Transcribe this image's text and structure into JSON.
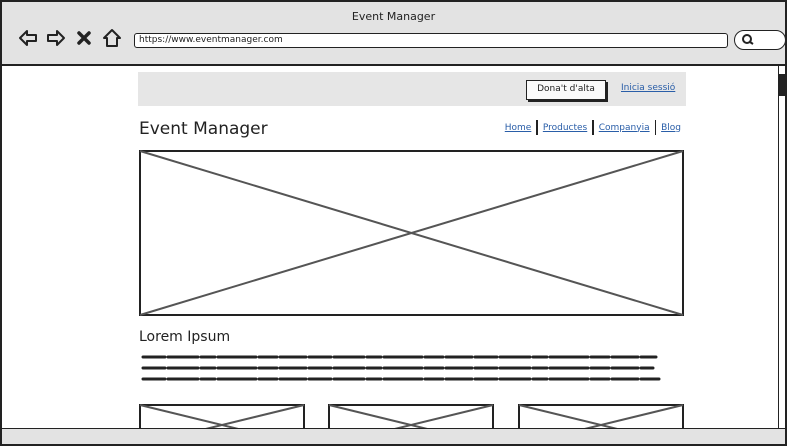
{
  "window": {
    "title": "Event Manager"
  },
  "browser": {
    "url": "https://www.eventmanager.com",
    "icons": [
      "back-arrow-icon",
      "forward-arrow-icon",
      "close-x-icon",
      "home-icon",
      "search-icon"
    ]
  },
  "header": {
    "signup_label": "Dona't d'alta",
    "login_label": "Inicia sessió"
  },
  "site": {
    "brand": "Event Manager",
    "nav": [
      "Home",
      "Productes",
      "Companyia",
      "Blog"
    ]
  },
  "content": {
    "section_title": "Lorem Ipsum"
  },
  "colors": {
    "link": "#2a5ea8",
    "chrome": "#e3e3e3",
    "header_bar": "#e6e6e6",
    "placeholder_stroke": "#555555"
  }
}
